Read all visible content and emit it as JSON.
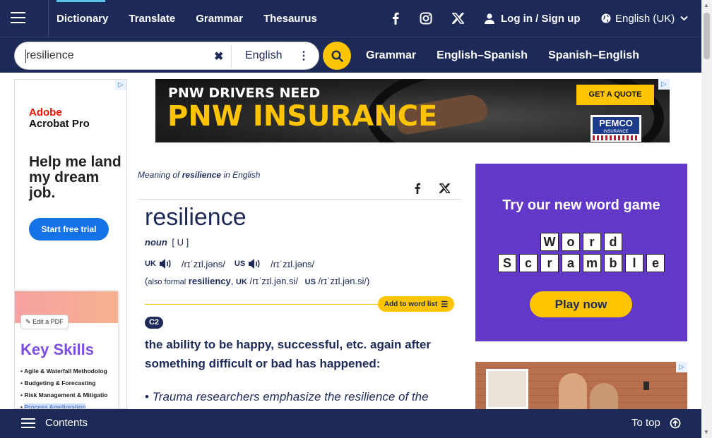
{
  "topnav": {
    "items": [
      "Dictionary",
      "Translate",
      "Grammar",
      "Thesaurus"
    ],
    "login": "Log in / Sign up",
    "language": "English (UK)"
  },
  "search": {
    "value": "resilience",
    "dict_lang": "English",
    "links": [
      "Grammar",
      "English–Spanish",
      "Spanish–English"
    ]
  },
  "ad_left": {
    "brand_line1": "Adobe",
    "brand_line2": "Acrobat Pro",
    "headline": "Help me land my dream job.",
    "cta": "Start free trial",
    "edit_pdf": "Edit a PDF",
    "key_skills": "Key Skills",
    "skills": [
      "Agile & Waterfall Methodolog",
      "Budgeting & Forecasting",
      "Risk Management & Mitigatio",
      "Process Amelioration"
    ]
  },
  "ad_top": {
    "line1": "PNW DRIVERS NEED",
    "line2": "PNW INSURANCE",
    "cta": "GET A QUOTE",
    "logo1": "PEMCO",
    "logo2": "INSURANCE"
  },
  "ad_right": {
    "title": "Try our new word game",
    "word1": [
      "W",
      "o",
      "r",
      "d"
    ],
    "word2": [
      "S",
      "c",
      "r",
      "a",
      "m",
      "b",
      "l",
      "e"
    ],
    "cta": "Play now"
  },
  "entry": {
    "meaning_prefix": "Meaning of",
    "meaning_word": "resilience",
    "meaning_suffix": "in English",
    "headword": "resilience",
    "pos": "noun",
    "grammar": "[ U ]",
    "uk_label": "UK",
    "uk_ipa": "/rɪˈzɪl.jəns/",
    "us_label": "US",
    "us_ipa": "/rɪˈzɪl.jəns/",
    "also_formal": "also formal",
    "alt_word": "resiliency",
    "alt_uk_ipa": "/rɪˈzɪl.jən.si/",
    "alt_us_ipa": "/rɪˈzɪl.jən.si/",
    "add_to_list": "Add to word list",
    "level": "C2",
    "definition": "the ability to be happy, successful, etc. again after something difficult or bad has happened:",
    "example": "Trauma researchers emphasize the resilience of the"
  },
  "bottombar": {
    "contents": "Contents",
    "to_top": "To top"
  },
  "colors": {
    "navy": "#1d2a57",
    "accent_yellow": "#fec400",
    "game_purple": "#6238c8",
    "adobe_red": "#eb1000"
  }
}
